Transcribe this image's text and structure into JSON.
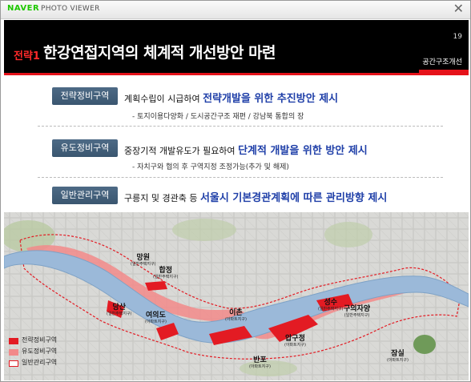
{
  "window": {
    "brand": "NAVER",
    "app_name": "PHOTO VIEWER",
    "close_glyph": "✕"
  },
  "slide": {
    "page_number": "19",
    "title_accent": "전략1",
    "title": "한강연접지역의 체계적 개선방안 마련",
    "section_label": "공간구조개선",
    "zones": [
      {
        "label": "전략정비구역",
        "desc_prefix": "계획수립이 시급하여 ",
        "desc_highlight": "전략개발을 위한 추진방안 제시",
        "desc_suffix": "",
        "sub": "- 토지이용다양화 / 도시공간구조 재편 / 강남북 통합의 장"
      },
      {
        "label": "유도정비구역",
        "desc_prefix": "중장기적 개발유도가 필요하여 ",
        "desc_highlight": "단계적 개발을 위한 방안 제시",
        "desc_suffix": "",
        "sub": "- 자치구와 협의 후 구역지정 조정가능(추가 및 해제)"
      },
      {
        "label": "일반관리구역",
        "desc_prefix": "구릉지 및 경관축 등 ",
        "desc_highlight": "서울시 기본경관계획에 따른 관리방향 제시",
        "desc_suffix": "",
        "sub": ""
      }
    ],
    "map": {
      "places": [
        {
          "name": "망원",
          "note": "(일반주택지구)"
        },
        {
          "name": "합정",
          "note": "(일반주택지구)"
        },
        {
          "name": "당산",
          "note": "(일반주택지구)"
        },
        {
          "name": "여의도",
          "note": "(아파트지구)"
        },
        {
          "name": "이촌",
          "note": "(아파트지구)"
        },
        {
          "name": "압구정",
          "note": "(아파트지구)"
        },
        {
          "name": "반포",
          "note": "(아파트지구)"
        },
        {
          "name": "성수",
          "note": "(일반주택지구)"
        },
        {
          "name": "구의자양",
          "note": "(일반주택지구)"
        },
        {
          "name": "잠실",
          "note": "(아파트지구)"
        }
      ],
      "legend": [
        {
          "label": "전략정비구역",
          "color": "#e31b23"
        },
        {
          "label": "유도정비구역",
          "color": "#f28a8a"
        },
        {
          "label": "일반관리구역",
          "color": "#ffffff"
        }
      ]
    }
  }
}
